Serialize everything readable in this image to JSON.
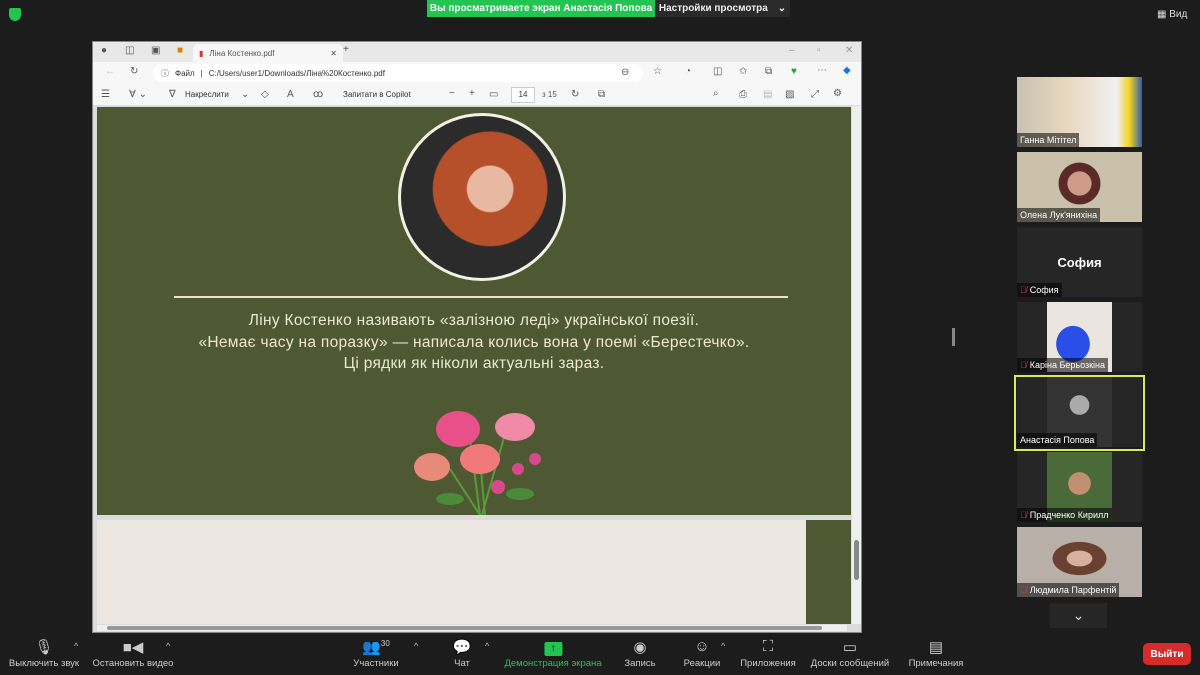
{
  "banner": {
    "sharing": "Вы просматриваете экран Анастасія Попова",
    "view_settings": "Настройки просмотра",
    "view": "Вид"
  },
  "browser": {
    "tab_title": "Ліна Костенко.pdf",
    "url_label": "Файл",
    "url": "C:/Users/user1/Downloads/Ліна%20Костенко.pdf",
    "draw_label": "Накреслити",
    "copilot_label": "Запитати в Copilot",
    "page_current": "14",
    "page_total": "з 15"
  },
  "slide": {
    "lines": [
      "Ліну Костенко називають «залізною леді» української поезії.",
      "«Немає часу на поразку» — написала колись вона у поемі «Берестечко».",
      "Ці рядки як ніколи актуальні зараз."
    ]
  },
  "participants": [
    {
      "name": "Ганна Мітітел",
      "muted": false
    },
    {
      "name": "Олена Лук'янихіна",
      "muted": false
    },
    {
      "name": "София",
      "muted": true,
      "avatar_text": "София"
    },
    {
      "name": "Каріна Берьозкіна",
      "muted": true
    },
    {
      "name": "Анастасія Попова",
      "muted": false,
      "active": true
    },
    {
      "name": "Прадченко Кирилл",
      "muted": true
    },
    {
      "name": "Людмила Парфентій",
      "muted": true
    }
  ],
  "toolbar": {
    "mute": "Выключить звук",
    "video": "Остановить видео",
    "participants": "Участники",
    "participants_count": "30",
    "chat": "Чат",
    "share": "Демонстрация экрана",
    "record": "Запись",
    "reactions": "Реакции",
    "apps": "Приложения",
    "whiteboards": "Доски сообщений",
    "notes": "Примечания",
    "leave": "Выйти"
  },
  "colors": {
    "share_green": "#23c552",
    "slide_green": "#4e5934",
    "active_border": "#d9ea5a",
    "leave_red": "#d62b2b"
  }
}
